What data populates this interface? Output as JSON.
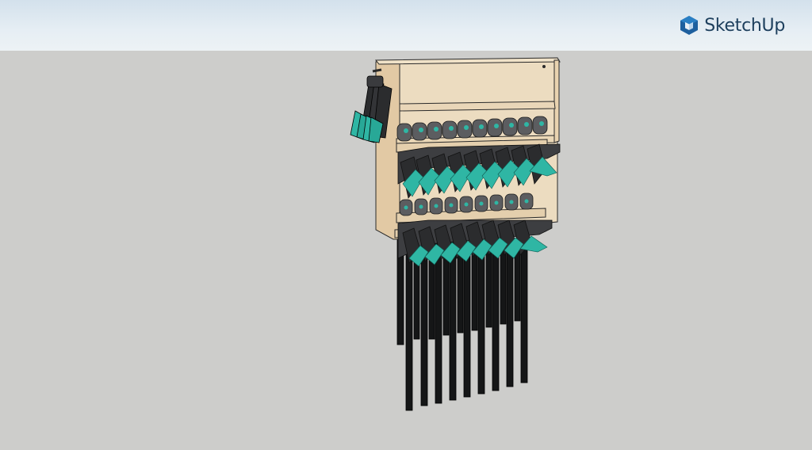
{
  "brand": {
    "name": "SketchUp",
    "icon": "sketchup-logo-icon",
    "color": "#1d3f5d"
  },
  "viewport": {
    "sky_color": "#dfe9f0",
    "ground_color": "#cdcdcb"
  },
  "model": {
    "subject": "wall-mounted-clamp-rack",
    "wood_color": "#e9d6b8",
    "clamp_accent_color": "#2fb6a4",
    "clamp_body_color": "#3a3b3e"
  }
}
